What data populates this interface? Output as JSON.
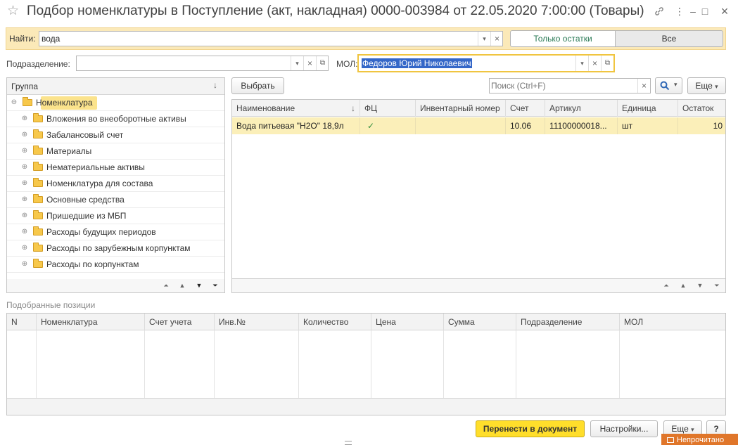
{
  "window": {
    "title": "Подбор номенклатуры в Поступление (акт, накладная) 0000-003984 от 22.05.2020 7:00:00 (Товары)",
    "controls": {
      "link": "🔗",
      "menu": "⋮",
      "minimize": "–",
      "maximize": "□",
      "close": "×"
    }
  },
  "search": {
    "label": "Найти:",
    "value": "вода",
    "toggle_only": "Только остатки",
    "toggle_all": "Все"
  },
  "filters": {
    "subdivision_label": "Подразделение:",
    "subdivision_value": "",
    "mol_label": "МОЛ:",
    "mol_value": "Федоров Юрий Николаевич"
  },
  "tree": {
    "header": "Группа",
    "root": "Номенклатура",
    "items": [
      "Вложения во внеоборотные активы",
      "Забалансовый счет",
      "Материалы",
      "Нематериальные активы",
      "Номенклатура для состава",
      "Основные средства",
      "Пришедшие из МБП",
      "Расходы будущих периодов",
      "Расходы по зарубежным корпунктам",
      "Расходы по корпунктам"
    ]
  },
  "toolbar": {
    "select_label": "Выбрать",
    "search_placeholder": "Поиск (Ctrl+F)",
    "more_label": "Еще"
  },
  "items_table": {
    "columns": [
      "Наименование",
      "ФЦ",
      "Инвентарный номер",
      "Счет",
      "Артикул",
      "Единица",
      "Остаток"
    ],
    "rows": [
      {
        "name": "Вода питьевая \"Н2О\" 18,9л",
        "fc": "✓",
        "inv": "",
        "account": "10.06",
        "article": "11100000018...",
        "unit": "шт",
        "stock": "10"
      }
    ]
  },
  "selected": {
    "title": "Подобранные позиции",
    "columns": [
      "N",
      "Номенклатура",
      "Счет учета",
      "Инв.№",
      "Количество",
      "Цена",
      "Сумма",
      "Подразделение",
      "МОЛ"
    ]
  },
  "footer": {
    "transfer_label": "Перенести в документ",
    "settings_label": "Настройки...",
    "more_label": "Еще",
    "help_label": "?",
    "notification_label": "Непрочитано"
  },
  "colors": {
    "accent_yellow": "#ffde2b",
    "selection": "#fbefb9",
    "search_strip": "#fbe9b8",
    "folder": "#f7c84b",
    "green_text": "#2a7a56",
    "notification": "#e0762a"
  }
}
